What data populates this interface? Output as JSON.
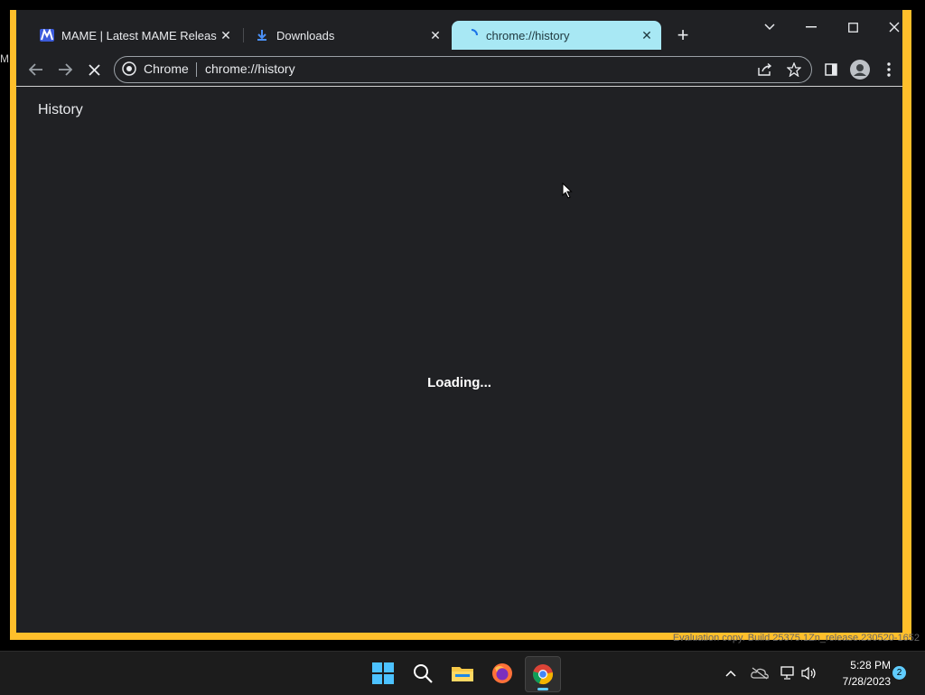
{
  "desktop": {
    "fragment_text": "M"
  },
  "tabs": [
    {
      "title": "MAME | Latest MAME Release",
      "icon": "mame-logo-icon",
      "active": false
    },
    {
      "title": "Downloads",
      "icon": "download-icon",
      "active": false
    },
    {
      "title": "chrome://history",
      "icon": "loading-spinner-icon",
      "active": true
    }
  ],
  "omnibox": {
    "chip_label": "Chrome",
    "url": "chrome://history"
  },
  "page": {
    "header_title": "History",
    "loading_text": "Loading..."
  },
  "taskbar": {
    "watermark": "Evaluation copy. Build 25375.1Zn_release.230520-1652",
    "time": "5:28 PM",
    "date": "7/28/2023",
    "notification_count": "2"
  },
  "colors": {
    "window_border": "#ffbf2b",
    "browser_bg": "#202124",
    "active_tab": "#a8e8f4",
    "accent": "#60cdff"
  }
}
